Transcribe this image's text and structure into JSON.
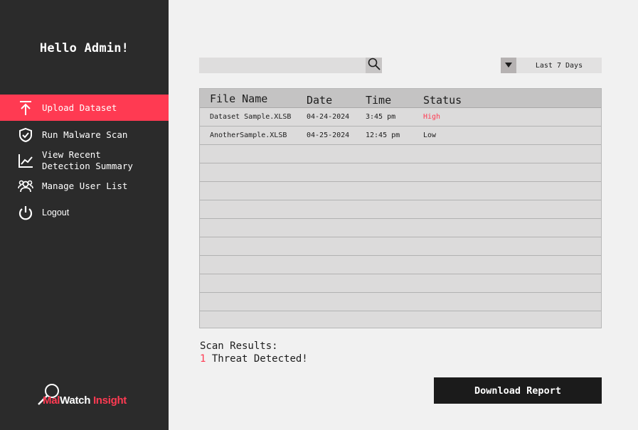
{
  "sidebar": {
    "greeting": "Hello Admin!",
    "items": [
      {
        "label": "Upload Dataset",
        "icon": "upload-icon",
        "active": true
      },
      {
        "label": "Run Malware Scan",
        "icon": "shield-check-icon"
      },
      {
        "label_line1": "View Recent",
        "label_line2": "Detection Summary",
        "icon": "line-chart-icon"
      },
      {
        "label": "Manage User List",
        "icon": "users-icon"
      },
      {
        "label": "Logout",
        "icon": "power-icon"
      }
    ],
    "logo": {
      "part1": "Mal",
      "part2": "Watch",
      "part3": "Insight"
    }
  },
  "search": {
    "placeholder": "",
    "value": "",
    "icon": "search-icon"
  },
  "filter": {
    "value": "Last 7 Days",
    "icon": "triangle-down-icon"
  },
  "table": {
    "headers": {
      "file": "File Name",
      "date": "Date",
      "time": "Time",
      "status": "Status"
    },
    "rows": [
      {
        "file": "Dataset Sample.XLSB",
        "date": "04-24-2024",
        "time": "3:45 pm",
        "status": "High"
      },
      {
        "file": "AnotherSample.XLSB",
        "date": "04-25-2024",
        "time": "12:45 pm",
        "status": "Low"
      }
    ]
  },
  "scan": {
    "title": "Scan Results:",
    "count": "1",
    "message": " Threat Detected!"
  },
  "download_label": "Download Report",
  "colors": {
    "accent": "#ff3a52",
    "sidebar": "#2b2b2b",
    "background": "#f1f1f1",
    "button": "#1b1b1b"
  }
}
